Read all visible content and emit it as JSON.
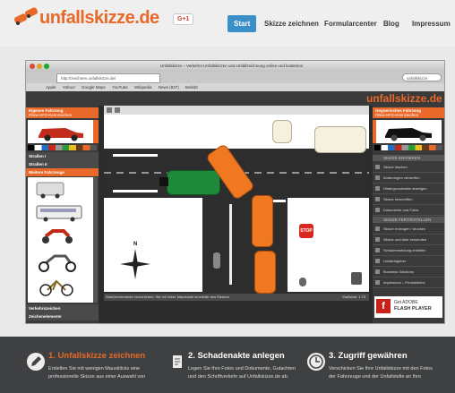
{
  "site": {
    "logo_text": "unfallskizze.de",
    "gplus_label": "G+1",
    "nav": [
      "Start",
      "Skizze zeichnen",
      "Formularcenter",
      "Blog",
      "Impressum"
    ]
  },
  "browser": {
    "window_title": "Unfallskizze – Verkehrs-Unfallskizzen und Unfallzeichnung online und kostenlos",
    "address": "http://zeichnen.unfallskizze.de/",
    "search_hint": "unfallskizze",
    "bookmarks": [
      "Apple",
      "Yahoo!",
      "Google Maps",
      "YouTube",
      "Wikipedia",
      "News (837)",
      "Beliebt"
    ]
  },
  "app": {
    "logo_text": "unfallskizze.de",
    "left_panel": {
      "header": "Eigenes Fahrzeug",
      "subheader": "Ohne KFZ-Kennzeichen",
      "sections": [
        "Straßen I",
        "Straßen II",
        "Weitere Fahrzeuge"
      ],
      "footer_items": [
        "Verkehrszeichen",
        "Zeichenelemente"
      ]
    },
    "right_panel": {
      "header": "Gegnerisches Fahrzeug",
      "subheader": "Ohne KFZ-Kennzeichen",
      "section1": "SKIZZE EDITIEREN",
      "edit_items": [
        "Skizze löschen",
        "Änderungen verwerfen",
        "Hintergrundraster anzeigen",
        "Skizze beschriften",
        "Dokumente und Fotos"
      ],
      "section2": "SKIZZE FERTIGSTELLEN",
      "finish_items": [
        "Skizze erzeugen / drucken",
        "Skizze und Akte versenden",
        "Schadenmeldung erstellen",
        "Unfallratgeber",
        "Business Solutions",
        "Impressum – Produktinfos"
      ],
      "flash_text_1": "Get ADOBE",
      "flash_text_2": "FLASH PLAYER"
    },
    "canvas": {
      "north_label": "N",
      "stop_label": "STOP"
    },
    "status_text": "Straßenelemente verschieben: Sie mit linker Maustaste innerhalb des Rasters.",
    "status_zoom": "Maßstab: 1:75"
  },
  "features": [
    {
      "title": "1. Unfallskizze zeichnen",
      "text_lines": [
        "Erstellen Sie mit wenigen Mausklicks eine",
        "professionelle Skizze aus einer Auswahl von"
      ],
      "icon": "pencil-icon"
    },
    {
      "title": "2. Schadenakte anlegen",
      "text_lines": [
        "Legen Sie Ihre Fotos und Dokumente, Gutachten",
        "und den Schriftverkehr auf Unfallskizze.de ab."
      ],
      "icon": "document-icon"
    },
    {
      "title": "3. Zugriff gewähren",
      "text_lines": [
        "Verschicken Sie Ihre Unfallskizze mit den Fotos",
        "der Fahrzeuge und der Unfallstelle an Ihre"
      ],
      "icon": "clock-icon"
    }
  ],
  "colors": {
    "brand_orange": "#e8692a",
    "nav_active": "#3b8fc8",
    "dark_band": "#3e4042"
  }
}
